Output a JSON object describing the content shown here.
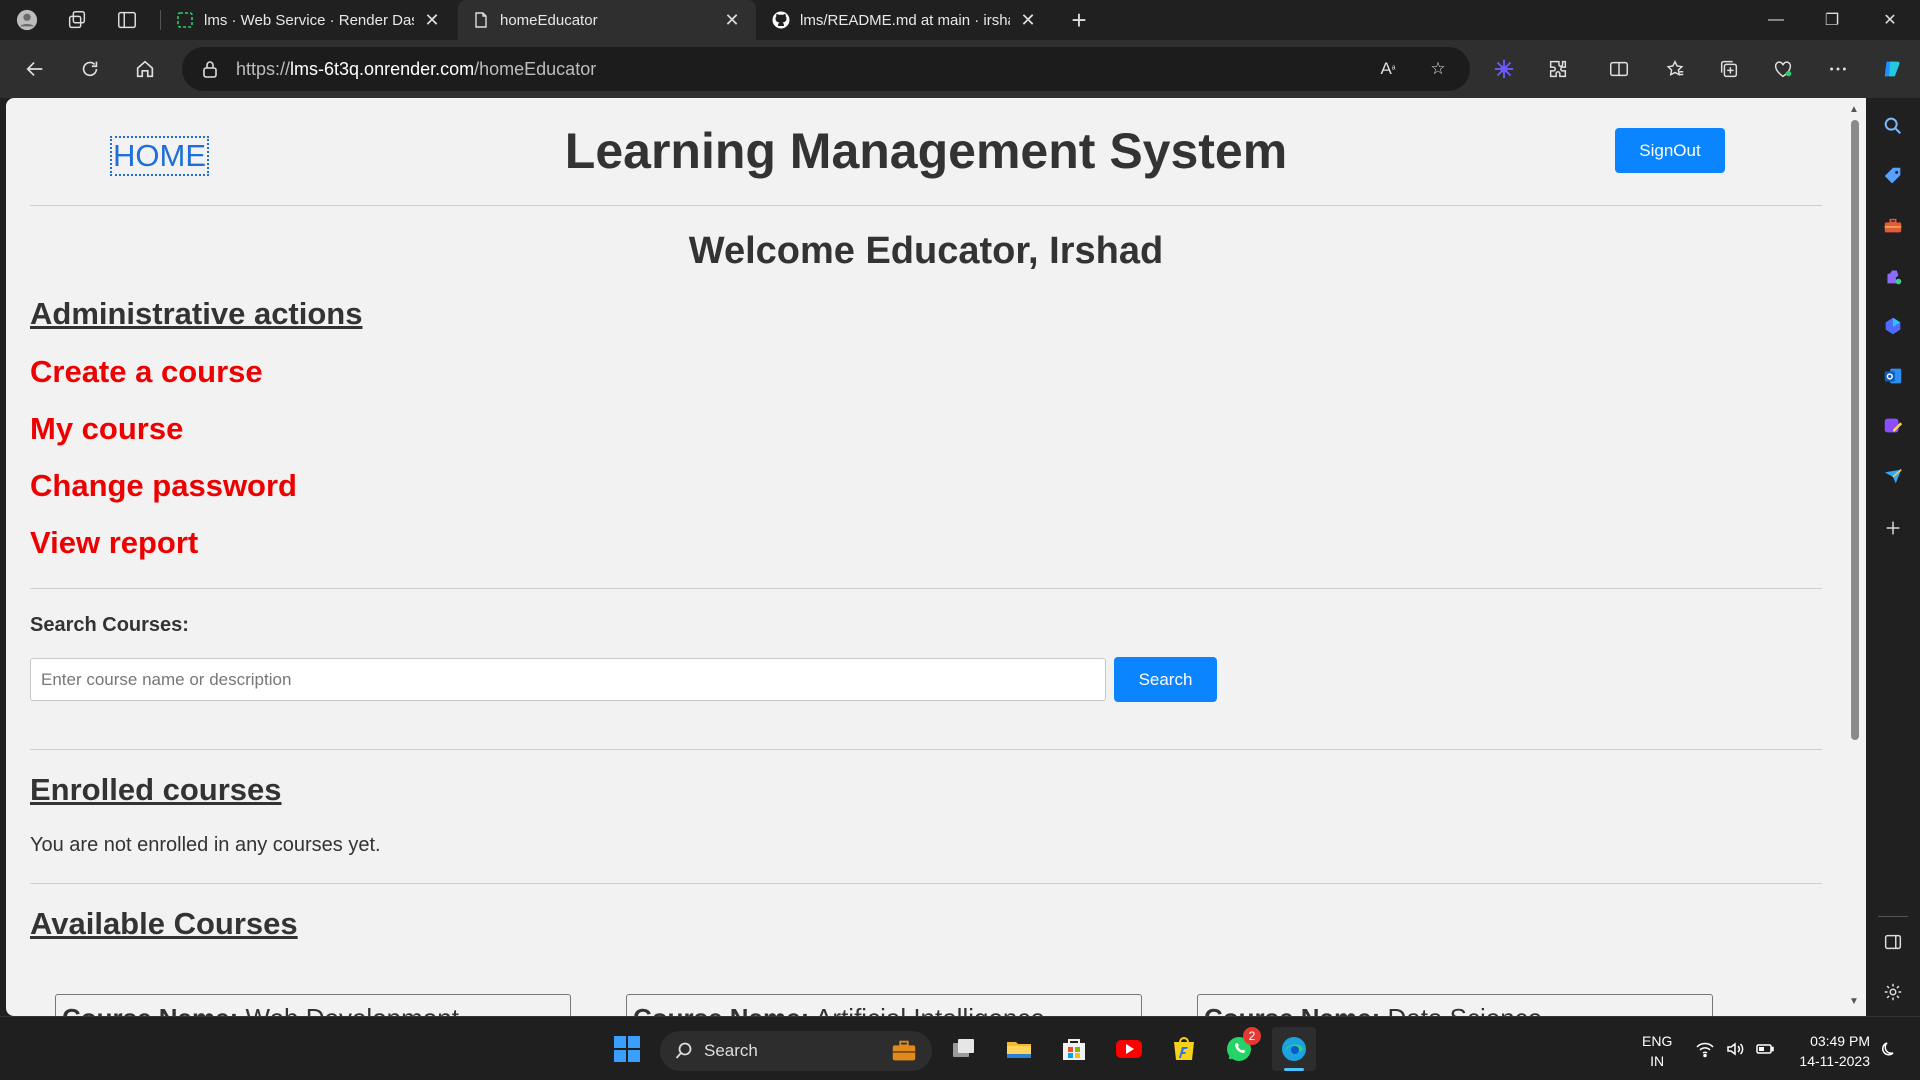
{
  "browser": {
    "tabs": [
      {
        "title": "lms · Web Service · Render Dashboard",
        "active": false
      },
      {
        "title": "homeEducator",
        "active": true
      },
      {
        "title": "lms/README.md at main · irshad",
        "active": false
      }
    ],
    "url_prefix": "https://",
    "url_host": "lms-6t3q.onrender.com",
    "url_path": "/homeEducator"
  },
  "page": {
    "home_link": "HOME",
    "site_title": "Learning Management System",
    "signout_label": "SignOut",
    "welcome": "Welcome Educator, Irshad",
    "admin_heading": "Administrative actions",
    "admin_links": [
      "Create a course",
      "My course",
      "Change password",
      "View report"
    ],
    "search": {
      "label": "Search Courses:",
      "placeholder": "Enter course name or description",
      "button_label": "Search"
    },
    "enrolled": {
      "heading": "Enrolled courses",
      "empty_text": "You are not enrolled in any courses yet."
    },
    "available": {
      "heading": "Available Courses",
      "name_label": "Course Name:",
      "courses": [
        "Web Development",
        "Artificial Intelligence",
        "Data Science"
      ]
    }
  },
  "taskbar": {
    "search_label": "Search",
    "whatsapp_badge": "2",
    "lang_line1": "ENG",
    "lang_line2": "IN",
    "time": "03:49 PM",
    "date": "14-11-2023"
  },
  "colors": {
    "accent_button": "#0a84ff",
    "admin_link": "#ee0000",
    "home_link": "#1e6fd9"
  }
}
